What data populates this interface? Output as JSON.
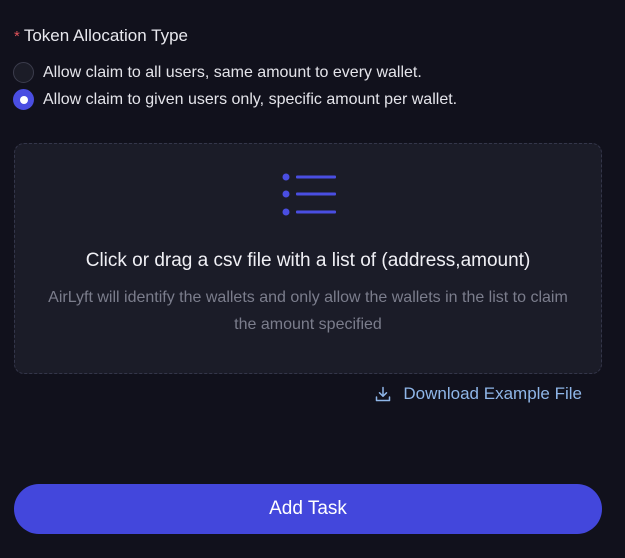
{
  "allocation": {
    "required_mark": "*",
    "label": "Token Allocation Type",
    "options": [
      {
        "label": "Allow claim to all users, same amount to every wallet.",
        "selected": false
      },
      {
        "label": "Allow claim to given users only, specific amount per wallet.",
        "selected": true
      }
    ]
  },
  "upload": {
    "icon": "list-icon",
    "title": "Click or drag a csv file with a list of (address,amount)",
    "description": "AirLyft will identify the wallets and only allow the wallets in the list to claim the amount specified"
  },
  "download": {
    "icon": "download-icon",
    "label": "Download Example File"
  },
  "submit": {
    "label": "Add Task"
  },
  "colors": {
    "background": "#11111c",
    "accent": "#4347dc",
    "link": "#8fb6e8",
    "required": "#e0525a"
  }
}
